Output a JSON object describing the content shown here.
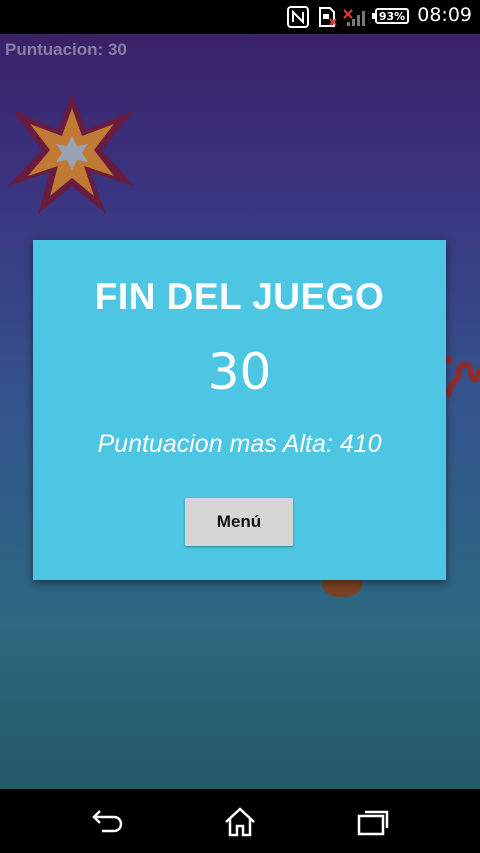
{
  "status_bar": {
    "time": "08:09",
    "battery_percent": "93%",
    "icons": [
      "nfc-icon",
      "sd-card-icon",
      "no-signal-icon",
      "signal-bars-icon",
      "battery-icon"
    ]
  },
  "hud": {
    "score_text": "Puntuacion: 30"
  },
  "dialog": {
    "title": "FIN DEL JUEGO",
    "score": "30",
    "high_score_text": "Puntuacion mas Alta: 410",
    "menu_label": "Menú",
    "background_color": "#4dc6e3"
  },
  "nav_bar": {
    "buttons": [
      "back-icon",
      "home-icon",
      "recents-icon"
    ]
  }
}
